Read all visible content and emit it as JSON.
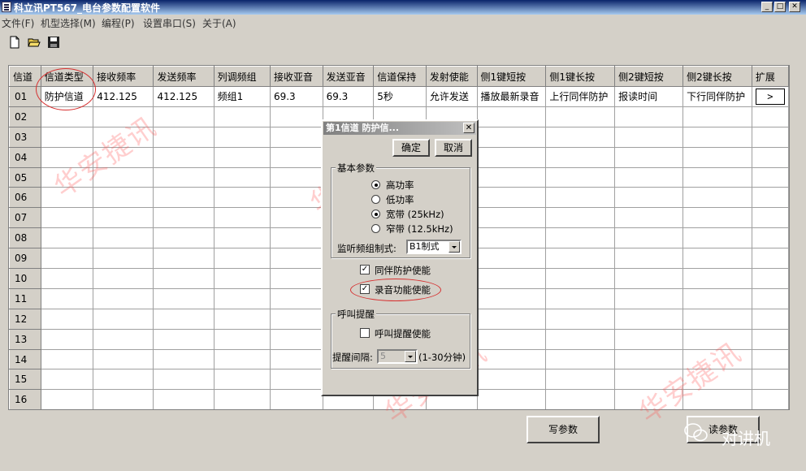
{
  "window": {
    "title": "科立讯PT567_电台参数配置软件"
  },
  "menu": [
    "文件(F)",
    "机型选择(M)",
    "编程(P)",
    "设置串口(S)",
    "关于(A)"
  ],
  "toolbar": {
    "icons": [
      "new-file-icon",
      "open-folder-icon",
      "save-icon"
    ]
  },
  "grid": {
    "headers": [
      "信道",
      "信道类型",
      "接收频率",
      "发送频率",
      "列调频组",
      "接收亚音",
      "发送亚音",
      "信道保持",
      "发射使能",
      "侧1键短按",
      "侧1键长按",
      "侧2键短按",
      "侧2键长按",
      "扩展"
    ],
    "rows": [
      "01",
      "02",
      "03",
      "04",
      "05",
      "06",
      "07",
      "08",
      "09",
      "10",
      "11",
      "12",
      "13",
      "14",
      "15",
      "16"
    ],
    "row1": [
      "防护信道",
      "412.125",
      "412.125",
      "频组1",
      "69.3",
      "69.3",
      "5秒",
      "允许发送",
      "播放最新录音",
      "上行同伴防护",
      "报读时间",
      "下行同伴防护",
      ">"
    ]
  },
  "buttons": {
    "write": "写参数",
    "read": "读参数"
  },
  "dialog": {
    "title": "第1信道 防护信...",
    "ok": "确定",
    "cancel": "取消",
    "basic_group": "基本参数",
    "options": {
      "high_power": "高功率",
      "low_power": "低功率",
      "wide": "宽带 (25kHz)",
      "narrow": "窄带 (12.5kHz)"
    },
    "monitor_label": "监听频组制式:",
    "monitor_value": "B1制式",
    "companion": "同伴防护使能",
    "record": "录音功能使能",
    "call_group": "呼叫提醒",
    "call_enable": "呼叫提醒使能",
    "interval_label": "提醒间隔:",
    "interval_value": "5",
    "interval_range": "(1-30分钟)",
    "power_selected": "high",
    "bandwidth_selected": "wide",
    "companion_checked": true,
    "record_checked": true,
    "call_checked": false
  },
  "watermark": "华安捷讯",
  "badge": "对讲机"
}
